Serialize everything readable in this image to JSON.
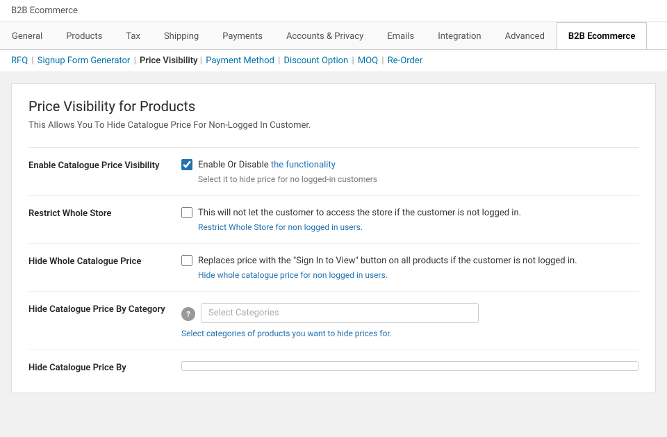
{
  "app": {
    "title": "B2B Ecommerce"
  },
  "tabs": [
    {
      "id": "general",
      "label": "General",
      "active": false
    },
    {
      "id": "products",
      "label": "Products",
      "active": false
    },
    {
      "id": "tax",
      "label": "Tax",
      "active": false
    },
    {
      "id": "shipping",
      "label": "Shipping",
      "active": false
    },
    {
      "id": "payments",
      "label": "Payments",
      "active": false
    },
    {
      "id": "accounts-privacy",
      "label": "Accounts & Privacy",
      "active": false
    },
    {
      "id": "emails",
      "label": "Emails",
      "active": false
    },
    {
      "id": "integration",
      "label": "Integration",
      "active": false
    },
    {
      "id": "advanced",
      "label": "Advanced",
      "active": false
    },
    {
      "id": "b2b-ecommerce",
      "label": "B2B Ecommerce",
      "active": true
    }
  ],
  "sub_nav": {
    "items": [
      {
        "id": "rfq",
        "label": "RFQ",
        "current": false
      },
      {
        "id": "signup-form-generator",
        "label": "Signup Form Generator",
        "current": false
      },
      {
        "id": "price-visibility",
        "label": "Price Visibility",
        "current": true
      },
      {
        "id": "payment-method",
        "label": "Payment Method",
        "current": false
      },
      {
        "id": "discount-option",
        "label": "Discount Option",
        "current": false
      },
      {
        "id": "moq",
        "label": "MOQ",
        "current": false
      },
      {
        "id": "re-order",
        "label": "Re-Order",
        "current": false
      }
    ]
  },
  "page": {
    "title": "Price Visibility for Products",
    "description": "This Allows You To Hide Catalogue Price For Non-Logged In Customer."
  },
  "settings": [
    {
      "id": "enable-catalogue",
      "label": "Enable Catalogue Price Visibility",
      "checkbox_checked": true,
      "checkbox_label_prefix": "Enable Or Disable ",
      "checkbox_label_highlight": "the functionality",
      "help_text": "Select it to hide price for no logged-in customers"
    },
    {
      "id": "restrict-whole-store",
      "label": "Restrict Whole Store",
      "checkbox_checked": false,
      "checkbox_label_prefix": "This will not let the customer to access the store if the customer is not logged in.",
      "checkbox_label_highlight": "",
      "help_text": "Restrict Whole Store for non logged in users."
    },
    {
      "id": "hide-whole-catalogue",
      "label": "Hide Whole Catalogue Price",
      "checkbox_checked": false,
      "checkbox_label_prefix": "Replaces price with the \"Sign In to View\" button on all products if the customer is not logged in.",
      "checkbox_label_highlight": "",
      "help_text": "Hide whole catalogue price for non logged in users."
    },
    {
      "id": "hide-by-category",
      "label": "Hide Catalogue Price By Category",
      "has_help_icon": true,
      "has_select": true,
      "select_placeholder": "Select Categories",
      "help_text": "Select categories of products you want to hide prices for."
    },
    {
      "id": "hide-by-product",
      "label": "Hide Catalogue Price By",
      "has_select": true,
      "select_placeholder": "",
      "help_text": "",
      "partial": true
    }
  ],
  "colors": {
    "accent": "#2271b1",
    "active_tab_border": "#ccc"
  }
}
